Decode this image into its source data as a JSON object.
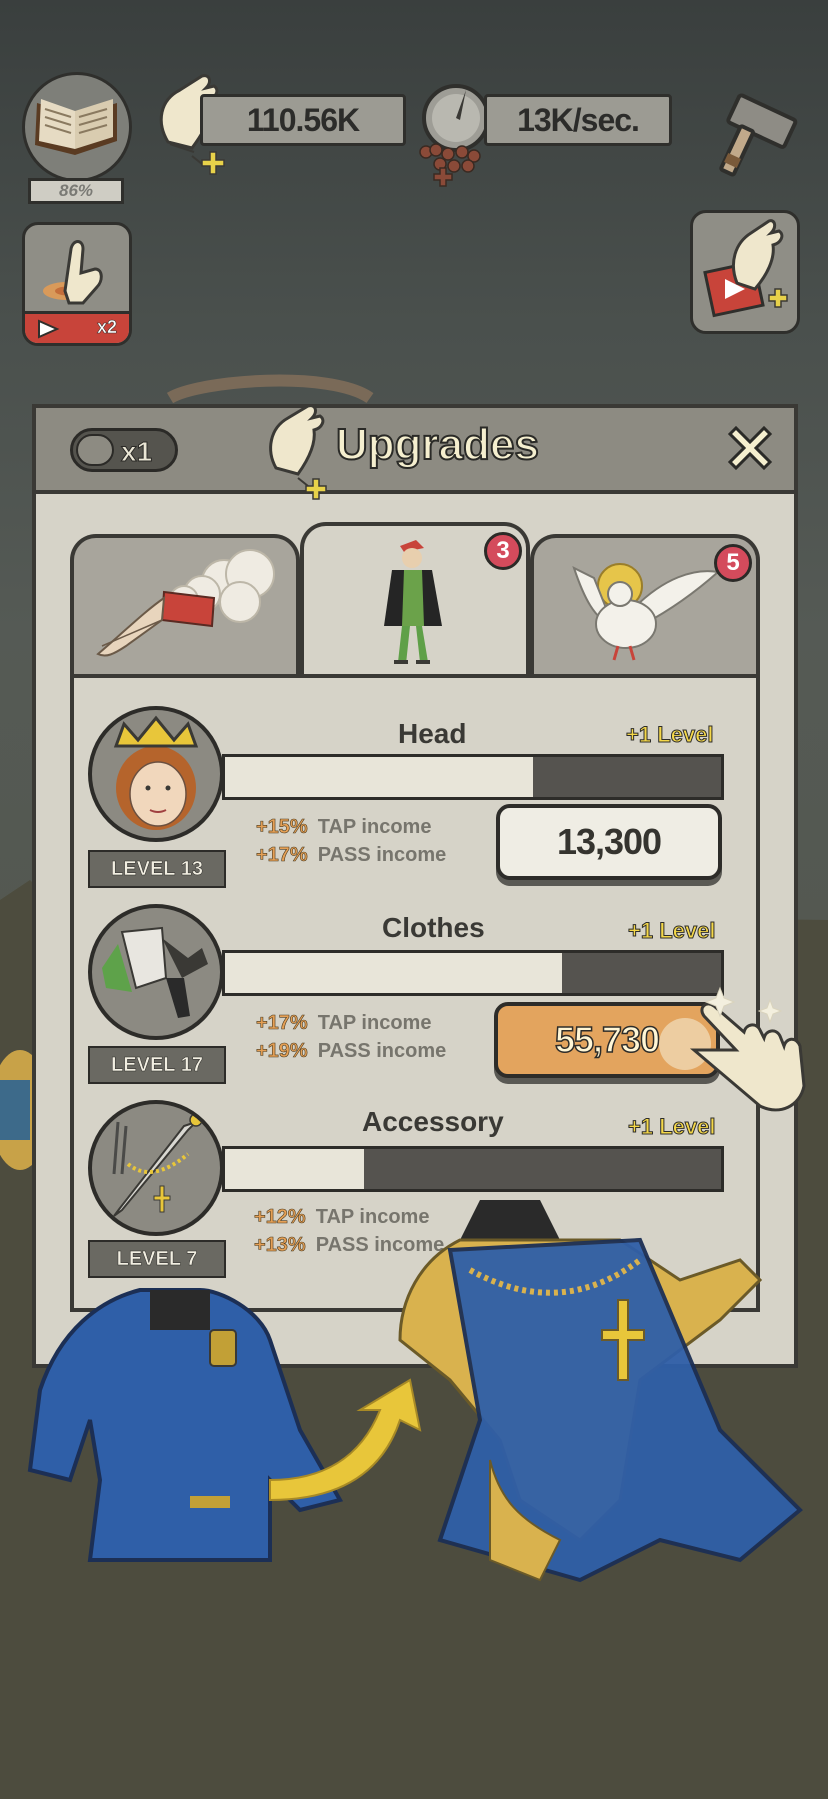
{
  "hud": {
    "book_progress": "86%",
    "tap_currency": "110.56K",
    "passive_rate": "13K/sec."
  },
  "side_buttons": {
    "tap_boost_label": "x2"
  },
  "panel": {
    "multiplier_label": "x1",
    "title": "Upgrades",
    "tabs": [
      {
        "name": "divine-hand",
        "badge": ""
      },
      {
        "name": "character",
        "badge": "3"
      },
      {
        "name": "dove",
        "badge": "5"
      }
    ],
    "items": [
      {
        "name": "Head",
        "plus_level": "+1 Level",
        "level": "LEVEL 13",
        "progress": 0.62,
        "tap_pct": "+15%",
        "tap_text": "TAP income",
        "pass_pct": "+17%",
        "pass_text": "PASS income",
        "price": "13,300",
        "affordable": true
      },
      {
        "name": "Clothes",
        "plus_level": "+1 Level",
        "level": "LEVEL 17",
        "progress": 0.68,
        "tap_pct": "+17%",
        "tap_text": "TAP income",
        "pass_pct": "+19%",
        "pass_text": "PASS income",
        "price": "55,730",
        "affordable": false
      },
      {
        "name": "Accessory",
        "plus_level": "+1 Level",
        "level": "LEVEL 7",
        "progress": 0.28,
        "tap_pct": "+12%",
        "tap_text": "TAP income",
        "pass_pct": "+13%",
        "pass_text": "PASS income"
      }
    ]
  },
  "colors": {
    "panel_bg": "#d6d3c8",
    "header_bg": "#8d8b82",
    "accent_gold": "#f5d84a",
    "bonus_orange": "#e5a056",
    "buy_orange": "#e3a45e",
    "badge_red": "#d44b5c",
    "tunic_blue": "#2f5fa8"
  }
}
